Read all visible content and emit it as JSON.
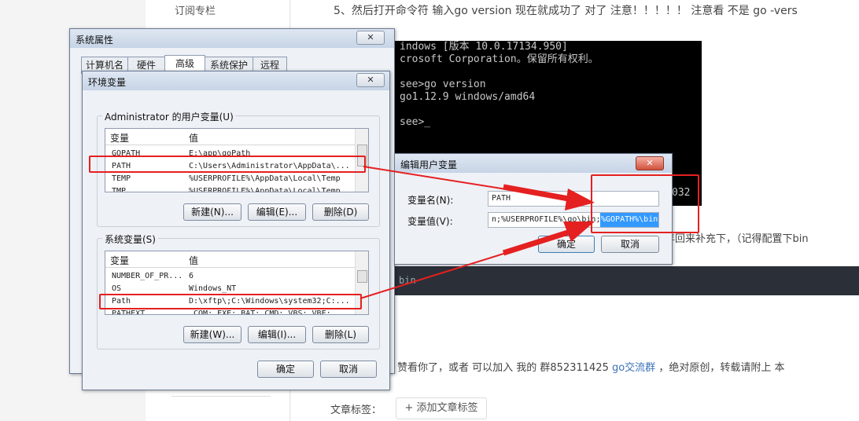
{
  "blog": {
    "sidebar_link": "订阅专栏",
    "heading": "5、然后打开命令符 输入go version 现在就成功了  对了  注意！！！！！ 注意看  不是  go -vers",
    "paragraph_fragment": "年回来补充下，（记得配置下bin",
    "code_bar_text": "bin",
    "footer_text_before": "赞看你了，或者 可以加入 我的 群852311425 ",
    "footer_link": "go交流群",
    "footer_text_after": " ，绝对原创，转载请附上 本",
    "tags_label": "文章标签：",
    "add_tag_button": "+ 添加文章标签",
    "console_tail": "032"
  },
  "console": {
    "lines": [
      "indows [版本 10.0.17134.950]",
      "crosoft Corporation。保留所有权利。",
      "see>go version",
      "go1.12.9 windows/amd64",
      "see>_"
    ]
  },
  "system_properties": {
    "title": "系统属性",
    "close": "✕",
    "tabs": [
      "计算机名",
      "硬件",
      "高级",
      "系统保护",
      "远程"
    ]
  },
  "env_dialog": {
    "title": "环境变量",
    "close": "✕",
    "user_group_label": "Administrator 的用户变量(U)",
    "col_variable": "变量",
    "col_value": "值",
    "user_vars": [
      {
        "name": "GOPATH",
        "value": "E:\\app\\goPath"
      },
      {
        "name": "PATH",
        "value": "C:\\Users\\Administrator\\AppData\\..."
      },
      {
        "name": "TEMP",
        "value": "%USERPROFILE%\\AppData\\Local\\Temp"
      },
      {
        "name": "TMP",
        "value": "%USERPROFILE%\\AppData\\Local\\Temp"
      }
    ],
    "user_new": "新建(N)...",
    "user_edit": "编辑(E)...",
    "user_delete": "删除(D)",
    "system_group_label": "系统变量(S)",
    "system_vars": [
      {
        "name": "NUMBER_OF_PR...",
        "value": "6"
      },
      {
        "name": "OS",
        "value": "Windows_NT"
      },
      {
        "name": "Path",
        "value": "D:\\xftp\\;C:\\Windows\\system32;C:..."
      },
      {
        "name": "PATHEXT",
        "value": ".COM;.EXE;.BAT;.CMD;.VBS;.VBE;..."
      }
    ],
    "system_new": "新建(W)...",
    "system_edit": "编辑(I)...",
    "system_delete": "删除(L)",
    "ok": "确定",
    "cancel": "取消"
  },
  "edit_dialog": {
    "title": "编辑用户变量",
    "close": "✕",
    "name_label": "变量名(N):",
    "name_value": "PATH",
    "value_label": "变量值(V):",
    "value_prefix": "n;%USERPROFILE%\\go\\bin;",
    "value_selected": "%GOPATH%\\bin",
    "ok": "确定",
    "cancel": "取消"
  },
  "colors": {
    "annotation_red": "#e52020",
    "selection_blue": "#3399ff",
    "console_bg": "#000000",
    "link_blue": "#3b73b9"
  }
}
